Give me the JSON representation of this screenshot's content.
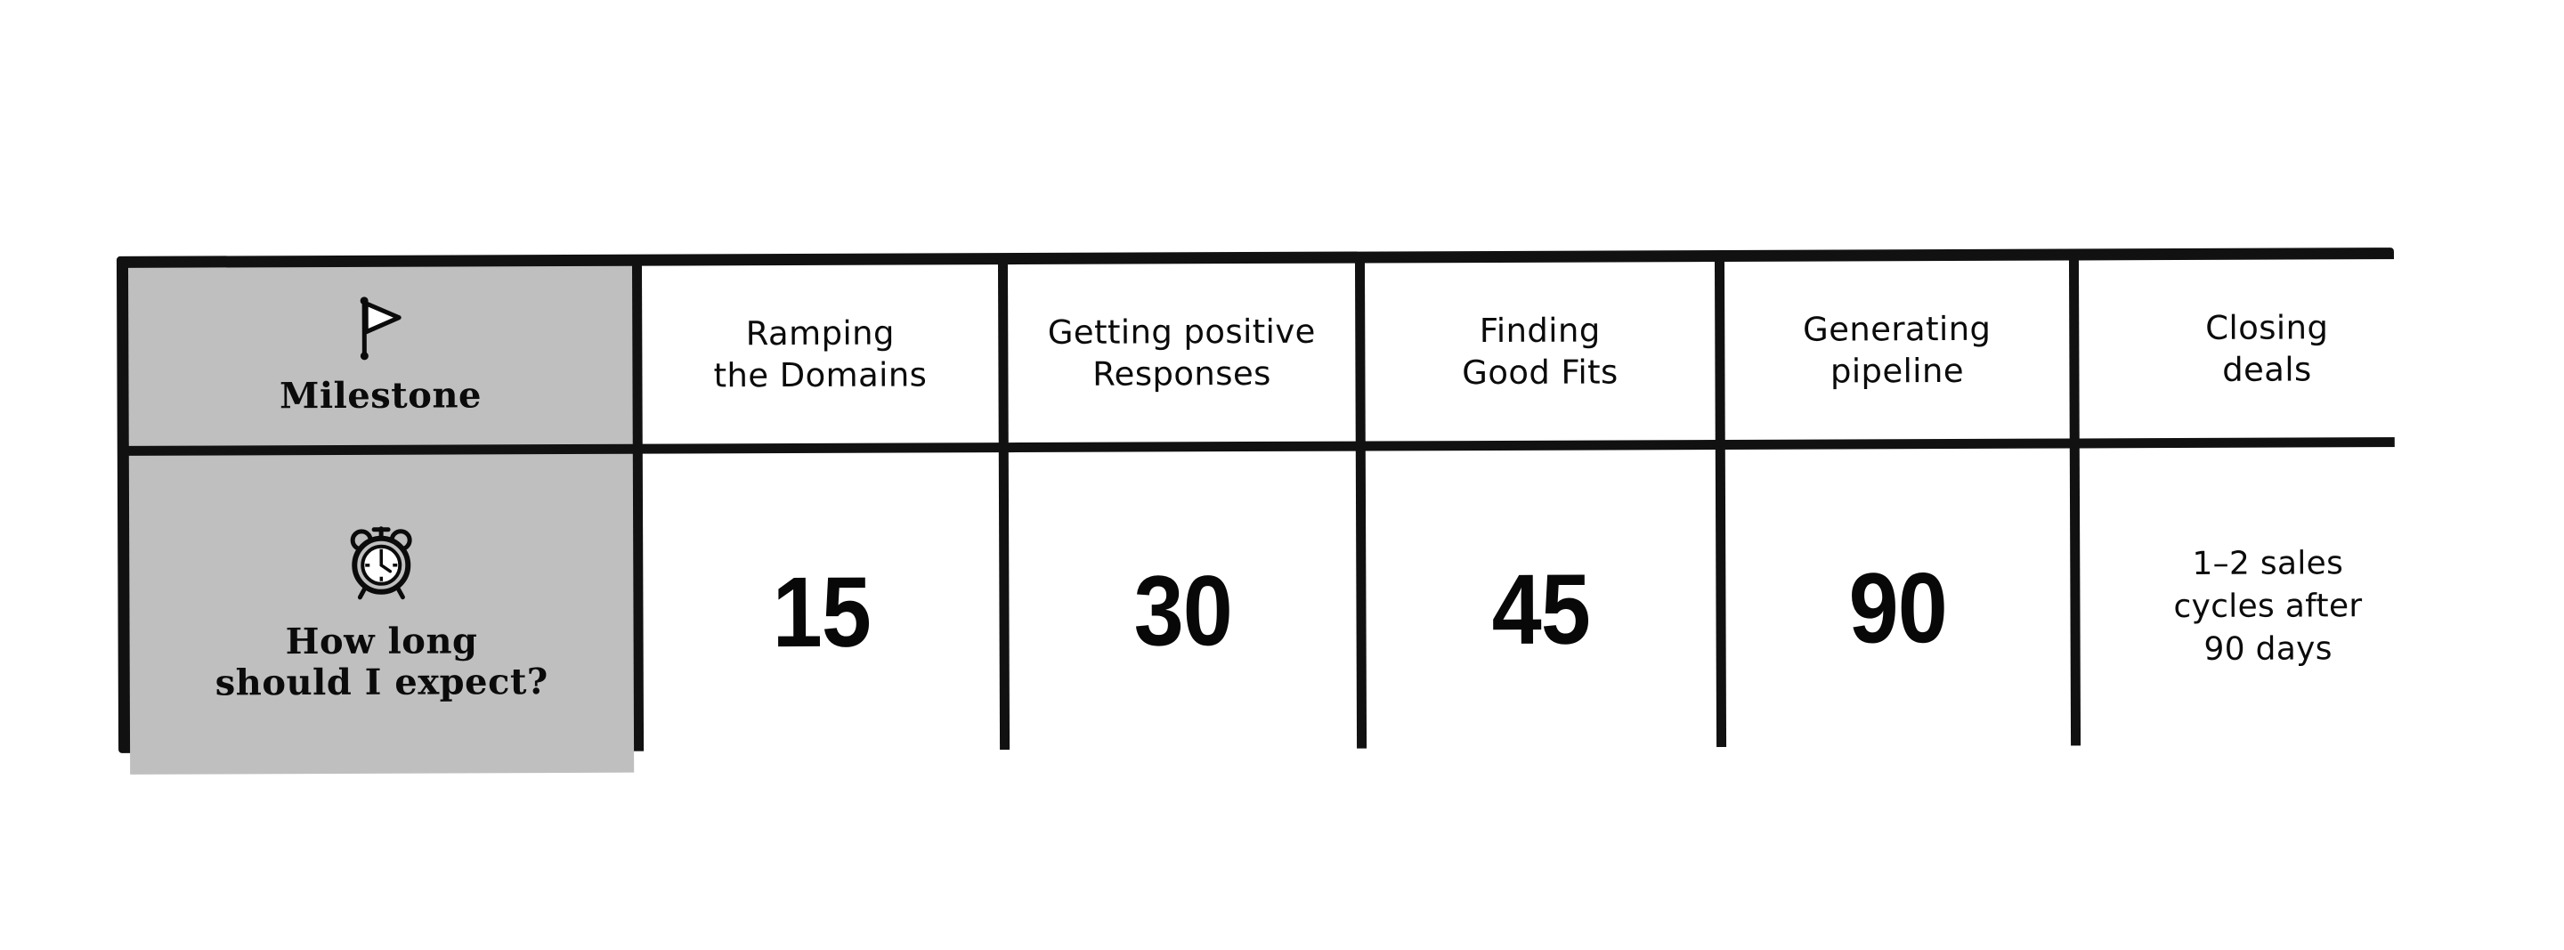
{
  "table": {
    "row_labels": [
      {
        "icon": "flag-icon",
        "text": "Milestone"
      },
      {
        "icon": "alarm-clock-icon",
        "line1": "How long",
        "line2": "should I expect?"
      }
    ],
    "columns": [
      {
        "header_line1": "Ramping",
        "header_line2": "the Domains",
        "value": "15"
      },
      {
        "header_line1": "Getting positive",
        "header_line2": "Responses",
        "value": "30"
      },
      {
        "header_line1": "Finding",
        "header_line2": "Good Fits",
        "value": "45"
      },
      {
        "header_line1": "Generating",
        "header_line2": "pipeline",
        "value": "90"
      },
      {
        "header_line1": "Closing",
        "header_line2": "deals",
        "value_line1": "1–2 sales",
        "value_line2": "cycles after",
        "value_line3": "90 days"
      }
    ]
  },
  "colors": {
    "shaded_cell": "#bfbfbf",
    "border": "#111111",
    "cell": "#ffffff",
    "text": "#0b0b0b",
    "page_background": "#ffffff"
  }
}
